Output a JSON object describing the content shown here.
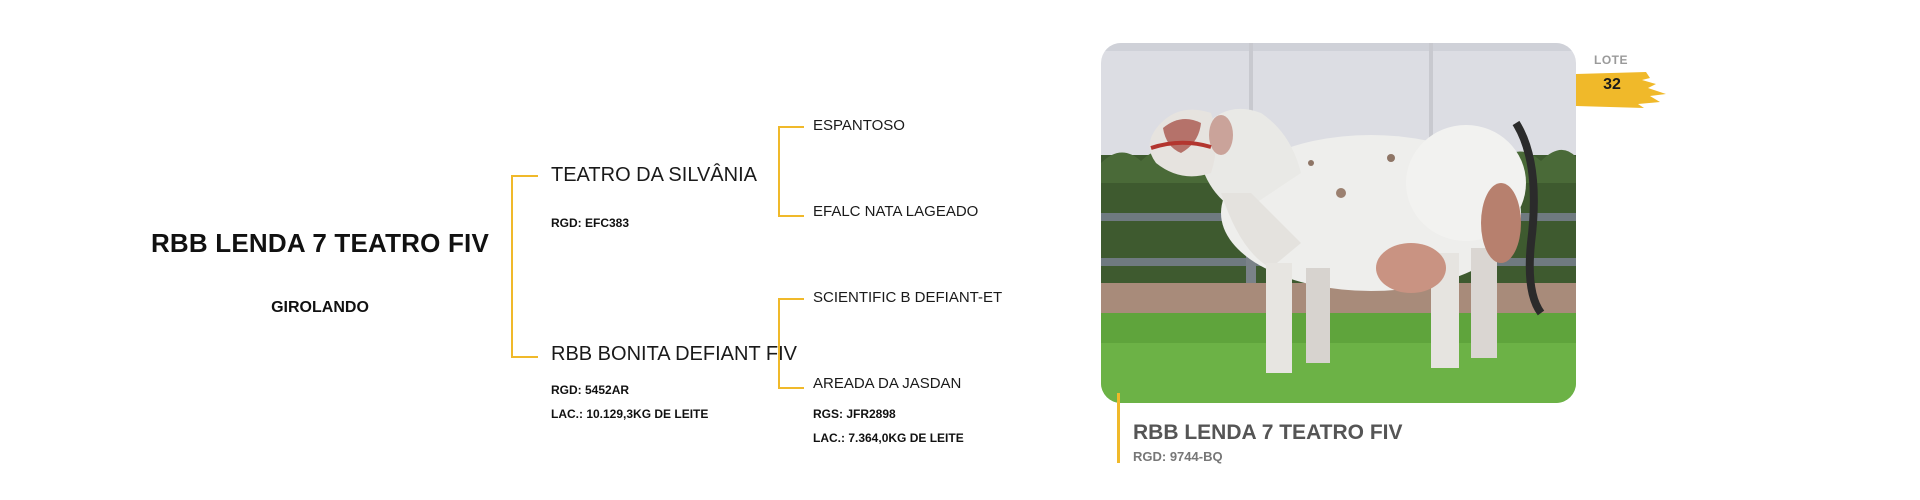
{
  "animal": {
    "name": "RBB LENDA 7 TEATRO FIV",
    "breed": "GIROLANDO"
  },
  "pedigree": {
    "sire": {
      "name": "TEATRO DA SILVÂNIA",
      "rgd": "RGD: EFC383",
      "sire": "ESPANTOSO",
      "dam": "EFALC NATA LAGEADO"
    },
    "dam": {
      "name": "RBB BONITA DEFIANT FIV",
      "rgd": "RGD: 5452AR",
      "lac": "LAC.: 10.129,3KG DE LEITE",
      "sire": "SCIENTIFIC B DEFIANT-ET",
      "dam": "AREADA DA JASDAN",
      "dam_rgs": "RGS: JFR2898",
      "dam_lac": "LAC.:  7.364,0KG DE LEITE"
    }
  },
  "lot": {
    "label": "LOTE",
    "number": "32"
  },
  "caption": {
    "name": "RBB LENDA 7 TEATRO FIV",
    "rgd": "RGD: 9744-BQ"
  },
  "colors": {
    "accent": "#f0b92a"
  }
}
